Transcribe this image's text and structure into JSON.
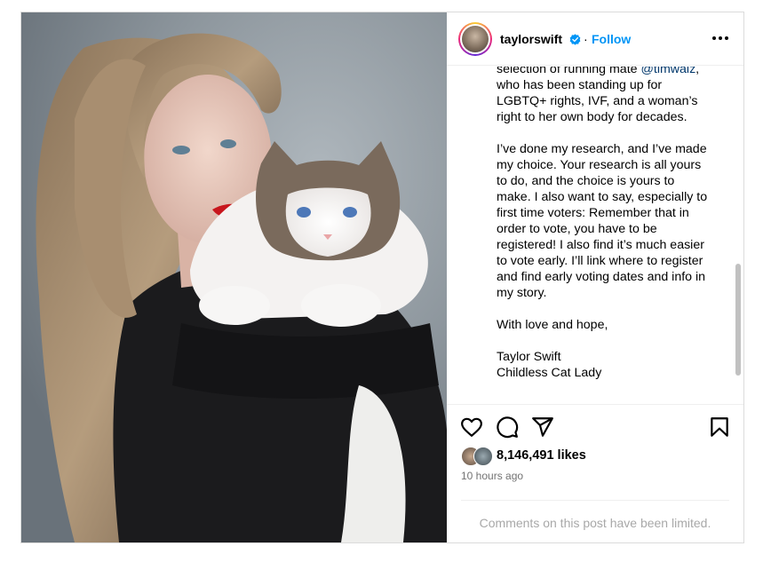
{
  "header": {
    "username": "taylorswift",
    "separator": "·",
    "follow_label": "Follow",
    "verified_icon": "verified-badge-icon",
    "more_icon": "more-options-icon"
  },
  "caption": {
    "lines": [
      "selection of running mate ",
      "@timwalz",
      ",\nwho has been standing up for\nLGBTQ+ rights, IVF, and a woman’s\nright to her own body for decades.\n\nI’ve done my research, and I’ve made\nmy choice. Your research is all yours\nto do, and the choice is yours to\nmake. I also want to say, especially to\nfirst time voters: Remember that in\norder to vote, you have to be\nregistered! I also find it’s much easier\nto vote early. I’ll link where to register\nand find early voting dates and info in\nmy story.\n\nWith love and hope,\n\nTaylor Swift\nChildless Cat Lady"
    ]
  },
  "actions": {
    "like_icon": "heart-icon",
    "comment_icon": "comment-icon",
    "share_icon": "share-icon",
    "save_icon": "bookmark-icon"
  },
  "likes": {
    "count_text": "8,146,491 likes"
  },
  "timestamp": "10 hours ago",
  "comments_notice": "Comments on this post have been limited.",
  "colors": {
    "accent": "#0095f6",
    "mention": "#00376b",
    "muted": "#737373",
    "notice": "#a8a8a8"
  }
}
